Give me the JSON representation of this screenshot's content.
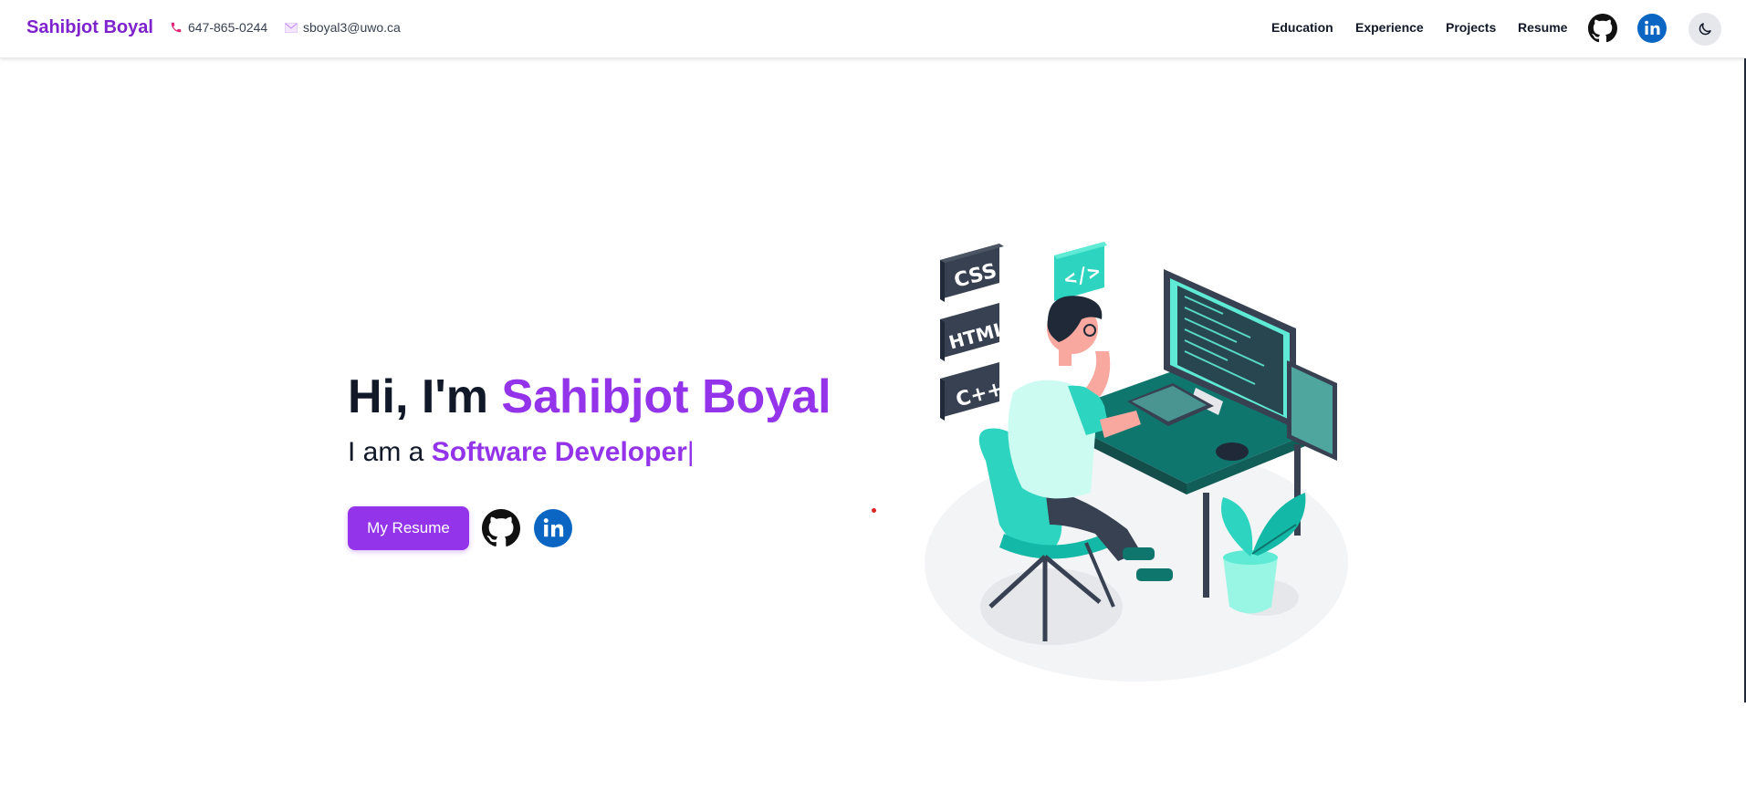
{
  "nav": {
    "brand": "Sahibjot Boyal",
    "phone": "647-865-0244",
    "email": "sboyal3@uwo.ca",
    "links": [
      "Education",
      "Experience",
      "Projects",
      "Resume"
    ],
    "icons": [
      "github-icon",
      "linkedin-icon",
      "moon-icon"
    ]
  },
  "hero": {
    "greeting": "Hi, I'm",
    "name": "Sahibjot Boyal",
    "subtitle_prefix": "I am a",
    "role": "Software Developer",
    "cursor": "|",
    "resume_button": "My Resume",
    "icons": [
      "github-icon",
      "linkedin-icon"
    ]
  },
  "illustration": {
    "tags": [
      "CSS",
      "HTML",
      "C++"
    ],
    "code_bubble": "</>"
  },
  "colors": {
    "accent": "#9333ea",
    "brand": "#7e22ce",
    "teal": "#2dd4bf",
    "linkedin": "#0a66c2"
  }
}
